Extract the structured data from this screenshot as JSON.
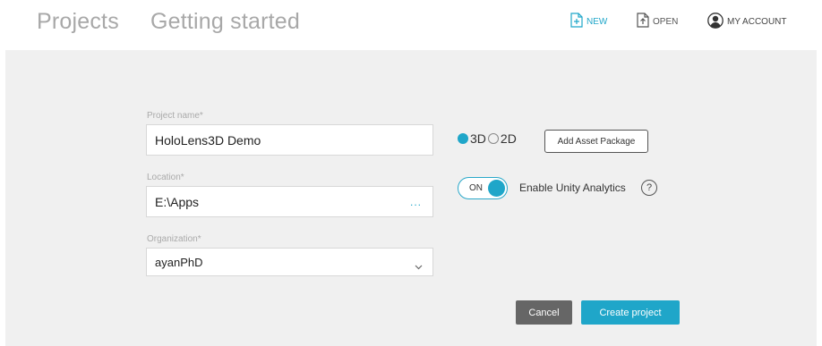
{
  "header": {
    "tabs": [
      {
        "label": "Projects"
      },
      {
        "label": "Getting started"
      }
    ],
    "actions": {
      "new_label": "NEW",
      "open_label": "OPEN",
      "account_label": "MY ACCOUNT"
    }
  },
  "form": {
    "project_name": {
      "label": "Project name*",
      "value": "HoloLens3D Demo"
    },
    "location": {
      "label": "Location*",
      "value": "E:\\Apps",
      "browse": "..."
    },
    "organization": {
      "label": "Organization*",
      "value": "ayanPhD"
    }
  },
  "options": {
    "mode_3d_label": "3D",
    "mode_2d_label": "2D",
    "selected_mode": "3D",
    "add_asset_label": "Add Asset Package",
    "toggle_label": "ON",
    "analytics_label": "Enable Unity Analytics",
    "help_label": "?"
  },
  "footer": {
    "cancel_label": "Cancel",
    "create_label": "Create project"
  },
  "colors": {
    "accent": "#1fa6c9",
    "cancel": "#666666",
    "panel_bg": "#f0f0f0"
  }
}
